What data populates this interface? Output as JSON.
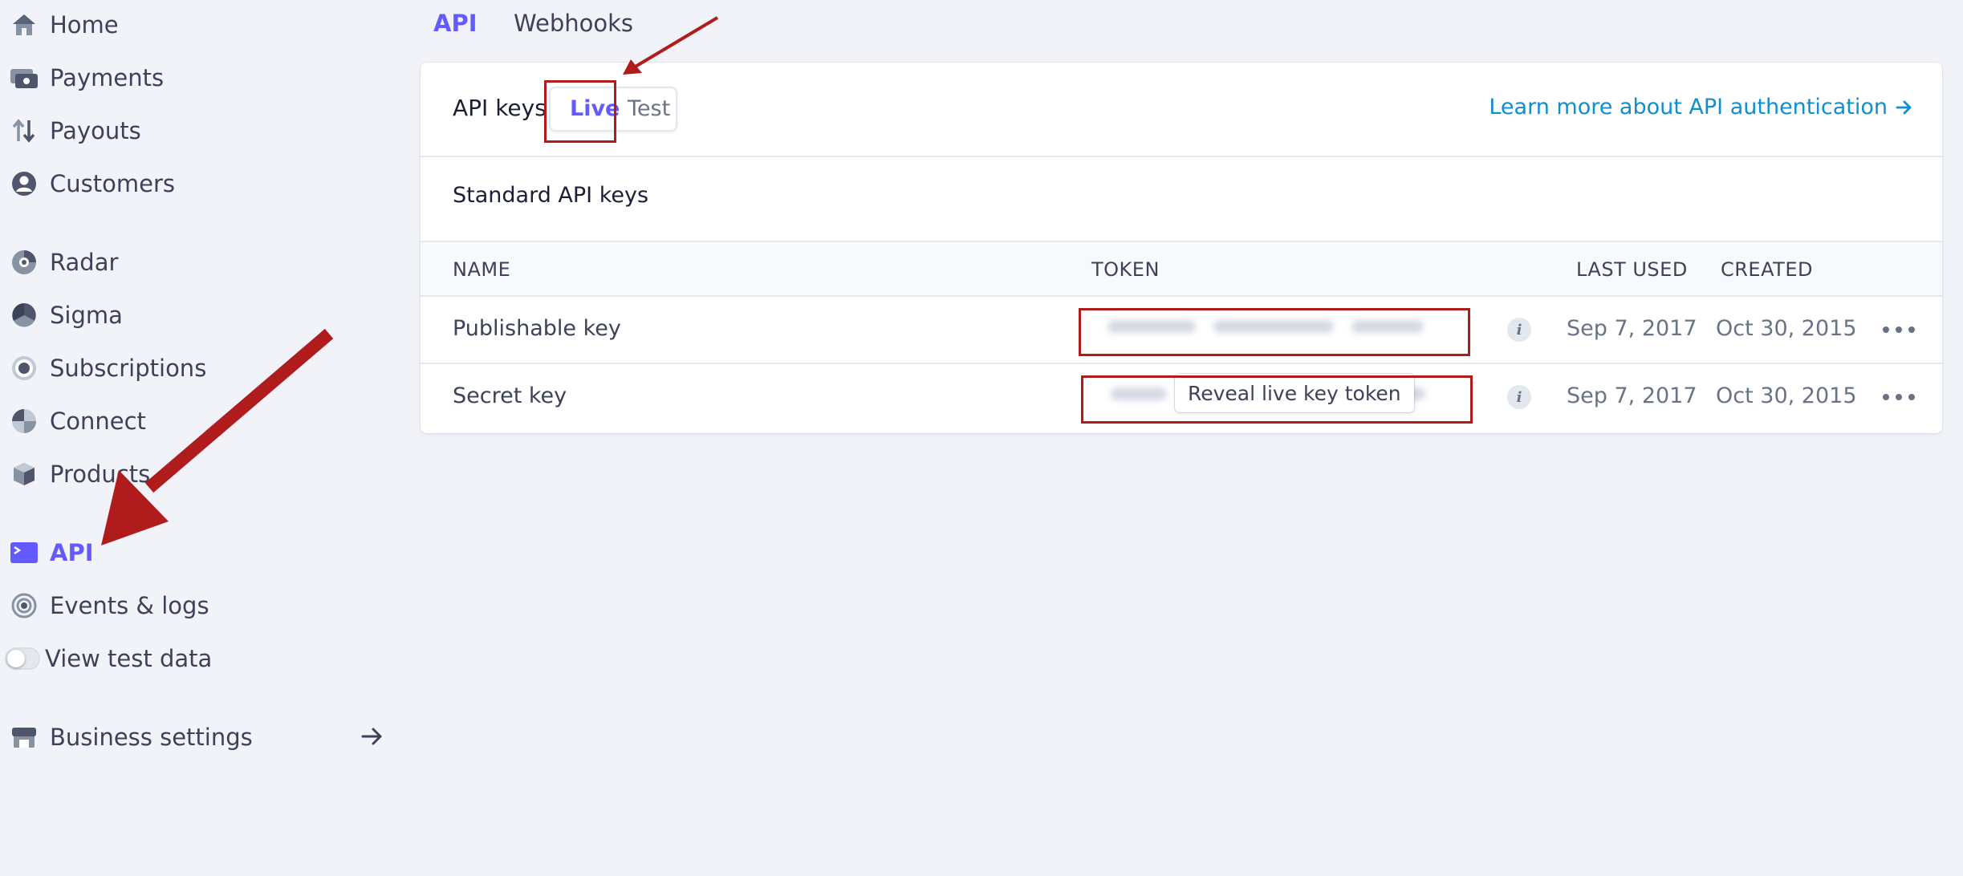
{
  "sidebar": {
    "items": [
      {
        "label": "Home",
        "icon": "home-icon"
      },
      {
        "label": "Payments",
        "icon": "payments-icon"
      },
      {
        "label": "Payouts",
        "icon": "payouts-icon"
      },
      {
        "label": "Customers",
        "icon": "customers-icon"
      },
      {
        "label": "Radar",
        "icon": "radar-icon"
      },
      {
        "label": "Sigma",
        "icon": "sigma-icon"
      },
      {
        "label": "Subscriptions",
        "icon": "subscriptions-icon"
      },
      {
        "label": "Connect",
        "icon": "connect-icon"
      },
      {
        "label": "Products",
        "icon": "products-icon"
      },
      {
        "label": "API",
        "icon": "api-icon",
        "active": true
      },
      {
        "label": "Events & logs",
        "icon": "events-icon"
      },
      {
        "label": "View test data",
        "icon": "toggle-switch"
      },
      {
        "label": "Business settings",
        "icon": "store-icon"
      }
    ]
  },
  "tabs": [
    "API",
    "Webhooks"
  ],
  "card": {
    "title": "API keys",
    "mode_live": "Live",
    "mode_test": "Test",
    "learn_link": "Learn more about API authentication",
    "section_title": "Standard API keys",
    "columns": {
      "name": "NAME",
      "token": "TOKEN",
      "last_used": "LAST USED",
      "created": "CREATED"
    },
    "rows": [
      {
        "name": "Publishable key",
        "last_used": "Sep 7, 2017",
        "created": "Oct 30, 2015"
      },
      {
        "name": "Secret key",
        "last_used": "Sep 7, 2017",
        "created": "Oct 30, 2015",
        "reveal_label": "Reveal live key token"
      }
    ]
  },
  "colors": {
    "accent": "#635bff",
    "link": "#0f8fcd",
    "annotation": "#b01c1c",
    "background": "#f1f3f9"
  }
}
